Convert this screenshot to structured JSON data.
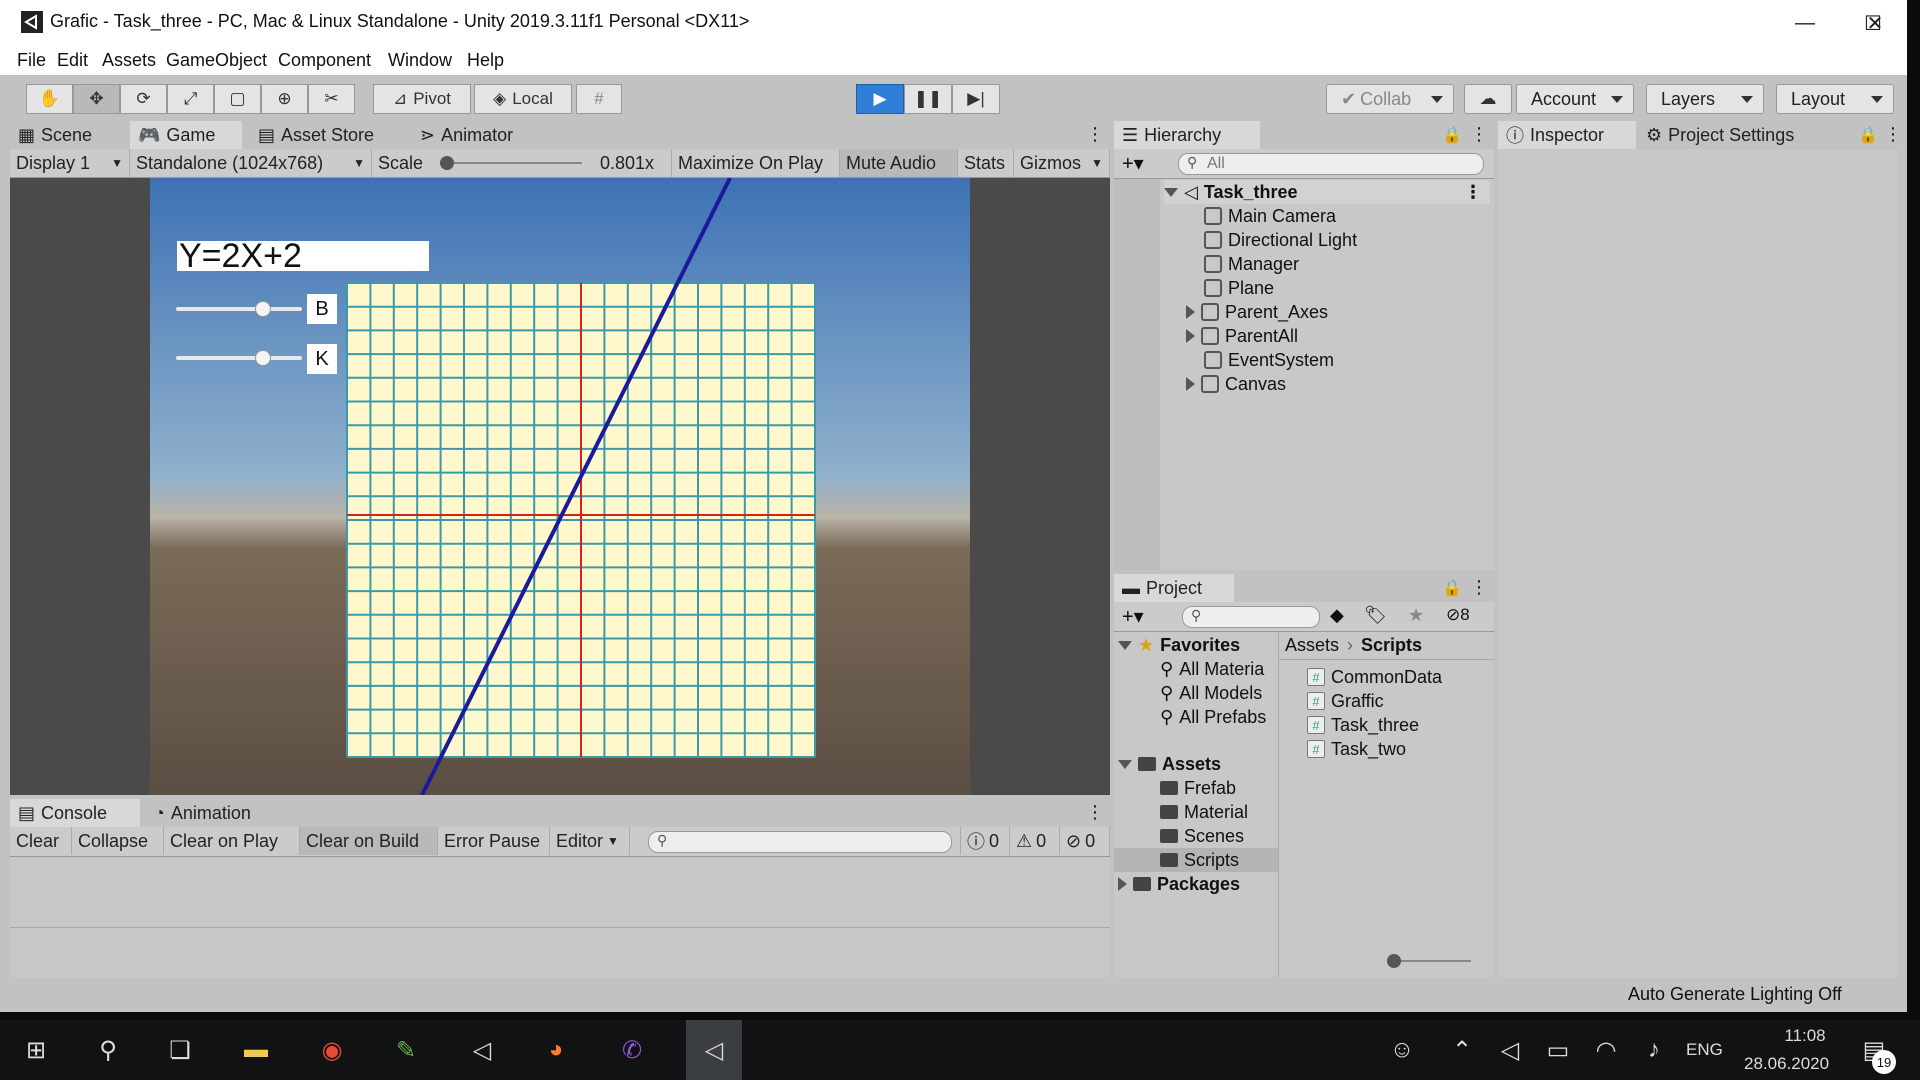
{
  "window": {
    "title": "Grafic - Task_three - PC, Mac & Linux Standalone - Unity 2019.3.11f1 Personal <DX11>",
    "minimize": "—",
    "maximize": "☐",
    "close": "✕"
  },
  "menu": [
    "File",
    "Edit",
    "Assets",
    "GameObject",
    "Component",
    "Window",
    "Help"
  ],
  "toolbar": {
    "pivot": "Pivot",
    "local": "Local",
    "collab": "Collab",
    "account": "Account",
    "layers": "Layers",
    "layout": "Layout"
  },
  "game_tabs": {
    "scene": "Scene",
    "game": "Game",
    "asset_store": "Asset Store",
    "animator": "Animator"
  },
  "game_controls": {
    "display": "Display 1",
    "resolution": "Standalone (1024x768)",
    "scale_label": "Scale",
    "scale_value": "0.801x",
    "maximize": "Maximize On Play",
    "mute": "Mute Audio",
    "stats": "Stats",
    "gizmos": "Gizmos"
  },
  "game_view": {
    "equation": "Y=2X+2",
    "slider_b_label": "B",
    "slider_k_label": "K",
    "slider_b_level": 0.69,
    "slider_k_level": 0.69
  },
  "hierarchy": {
    "tab": "Hierarchy",
    "search_placeholder": "All",
    "scene": "Task_three",
    "items": [
      "Main Camera",
      "Directional Light",
      "Manager",
      "Plane",
      "Parent_Axes",
      "ParentAll",
      "EventSystem",
      "Canvas"
    ]
  },
  "inspector": {
    "tab": "Inspector",
    "settings_tab": "Project Settings"
  },
  "project": {
    "tab": "Project",
    "hidden_count": "8",
    "favorites": "Favorites",
    "fav_items": [
      "All Materia",
      "All Models",
      "All Prefabs"
    ],
    "assets": "Assets",
    "asset_folders": [
      "Frefab",
      "Material",
      "Scenes",
      "Scripts"
    ],
    "packages": "Packages",
    "breadcrumb_root": "Assets",
    "breadcrumb_current": "Scripts",
    "scripts": [
      "CommonData",
      "Graffic",
      "Task_three",
      "Task_two"
    ]
  },
  "console": {
    "tab": "Console",
    "animation_tab": "Animation",
    "clear": "Clear",
    "collapse": "Collapse",
    "clear_on_play": "Clear on Play",
    "clear_on_build": "Clear on Build",
    "error_pause": "Error Pause",
    "editor": "Editor",
    "info_count": "0",
    "warn_count": "0",
    "error_count": "0"
  },
  "status_bar": {
    "lighting": "Auto Generate Lighting Off"
  },
  "taskbar": {
    "lang": "ENG",
    "time": "11:08",
    "date": "28.06.2020",
    "notifications": "19"
  },
  "colors": {
    "chrome": "#c2c2c2",
    "grid_fill": "#fff8cc",
    "grid_line": "#3a9aa8",
    "axis": "#d22222",
    "graph_line": "#1a1a9a",
    "play_blue": "#2f7fd8"
  }
}
